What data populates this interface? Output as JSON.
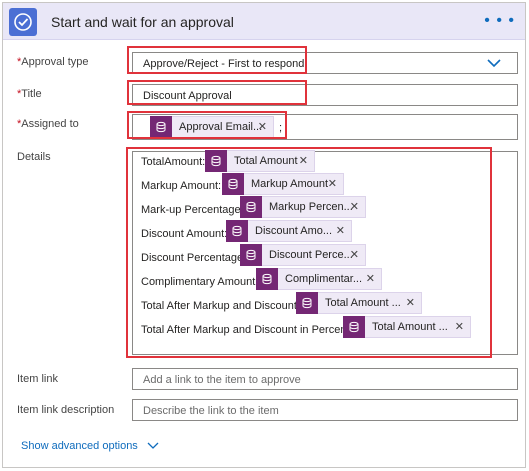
{
  "header": {
    "title": "Start and wait for an approval",
    "more_icon": "ellipsis-icon",
    "accent": "#4b6fd4",
    "background": "#e9e7f7"
  },
  "approval_type": {
    "label": "Approval type",
    "required_mark": "*",
    "value": "Approve/Reject - First to respond"
  },
  "title_field": {
    "label": "Title",
    "required_mark": "*",
    "value": "Discount Approval"
  },
  "assigned_to": {
    "label": "Assigned to",
    "required_mark": "*",
    "token": "Approval Email...",
    "suffix": ";"
  },
  "details": {
    "label": "Details",
    "rows": [
      {
        "text": "TotalAmount:",
        "token": "Total Amount"
      },
      {
        "text": "Markup Amount:",
        "token": "Markup Amount"
      },
      {
        "text": "Mark-up Percentage:",
        "token": "Markup Percen..."
      },
      {
        "text": "Discount Amount:",
        "token": "Discount Amo..."
      },
      {
        "text": "Discount Percentage:",
        "token": "Discount Perce..."
      },
      {
        "text": "Complimentary Amount:",
        "token": "Complimentar..."
      },
      {
        "text": "Total After Markup and Discount:",
        "token": "Total Amount ..."
      },
      {
        "text": "Total After Markup and Discount in Percent:",
        "token": "Total Amount ..."
      }
    ]
  },
  "item_link": {
    "label": "Item link",
    "placeholder": "Add a link to the item to approve"
  },
  "item_link_description": {
    "label": "Item link description",
    "placeholder": "Describe the link to the item"
  },
  "advanced": {
    "label": "Show advanced options"
  },
  "colors": {
    "token_icon": "#742774",
    "highlight": "#e0323b",
    "link": "#0f6cbd"
  }
}
